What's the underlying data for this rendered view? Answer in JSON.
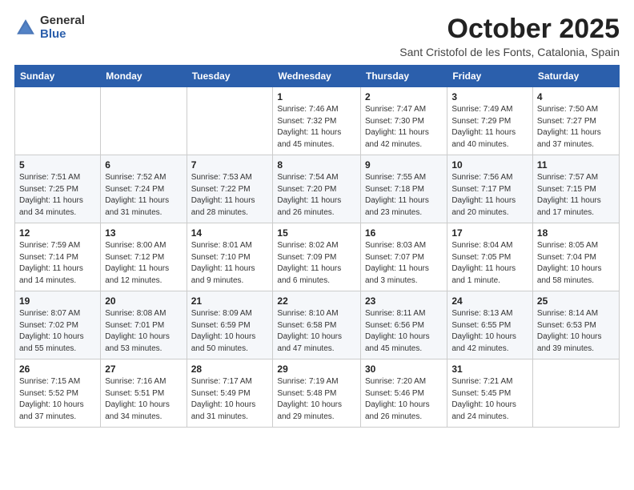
{
  "header": {
    "logo_general": "General",
    "logo_blue": "Blue",
    "month_title": "October 2025",
    "location": "Sant Cristofol de les Fonts, Catalonia, Spain"
  },
  "weekdays": [
    "Sunday",
    "Monday",
    "Tuesday",
    "Wednesday",
    "Thursday",
    "Friday",
    "Saturday"
  ],
  "rows": [
    [
      {
        "day": "",
        "info": ""
      },
      {
        "day": "",
        "info": ""
      },
      {
        "day": "",
        "info": ""
      },
      {
        "day": "1",
        "info": "Sunrise: 7:46 AM\nSunset: 7:32 PM\nDaylight: 11 hours\nand 45 minutes."
      },
      {
        "day": "2",
        "info": "Sunrise: 7:47 AM\nSunset: 7:30 PM\nDaylight: 11 hours\nand 42 minutes."
      },
      {
        "day": "3",
        "info": "Sunrise: 7:49 AM\nSunset: 7:29 PM\nDaylight: 11 hours\nand 40 minutes."
      },
      {
        "day": "4",
        "info": "Sunrise: 7:50 AM\nSunset: 7:27 PM\nDaylight: 11 hours\nand 37 minutes."
      }
    ],
    [
      {
        "day": "5",
        "info": "Sunrise: 7:51 AM\nSunset: 7:25 PM\nDaylight: 11 hours\nand 34 minutes."
      },
      {
        "day": "6",
        "info": "Sunrise: 7:52 AM\nSunset: 7:24 PM\nDaylight: 11 hours\nand 31 minutes."
      },
      {
        "day": "7",
        "info": "Sunrise: 7:53 AM\nSunset: 7:22 PM\nDaylight: 11 hours\nand 28 minutes."
      },
      {
        "day": "8",
        "info": "Sunrise: 7:54 AM\nSunset: 7:20 PM\nDaylight: 11 hours\nand 26 minutes."
      },
      {
        "day": "9",
        "info": "Sunrise: 7:55 AM\nSunset: 7:18 PM\nDaylight: 11 hours\nand 23 minutes."
      },
      {
        "day": "10",
        "info": "Sunrise: 7:56 AM\nSunset: 7:17 PM\nDaylight: 11 hours\nand 20 minutes."
      },
      {
        "day": "11",
        "info": "Sunrise: 7:57 AM\nSunset: 7:15 PM\nDaylight: 11 hours\nand 17 minutes."
      }
    ],
    [
      {
        "day": "12",
        "info": "Sunrise: 7:59 AM\nSunset: 7:14 PM\nDaylight: 11 hours\nand 14 minutes."
      },
      {
        "day": "13",
        "info": "Sunrise: 8:00 AM\nSunset: 7:12 PM\nDaylight: 11 hours\nand 12 minutes."
      },
      {
        "day": "14",
        "info": "Sunrise: 8:01 AM\nSunset: 7:10 PM\nDaylight: 11 hours\nand 9 minutes."
      },
      {
        "day": "15",
        "info": "Sunrise: 8:02 AM\nSunset: 7:09 PM\nDaylight: 11 hours\nand 6 minutes."
      },
      {
        "day": "16",
        "info": "Sunrise: 8:03 AM\nSunset: 7:07 PM\nDaylight: 11 hours\nand 3 minutes."
      },
      {
        "day": "17",
        "info": "Sunrise: 8:04 AM\nSunset: 7:05 PM\nDaylight: 11 hours\nand 1 minute."
      },
      {
        "day": "18",
        "info": "Sunrise: 8:05 AM\nSunset: 7:04 PM\nDaylight: 10 hours\nand 58 minutes."
      }
    ],
    [
      {
        "day": "19",
        "info": "Sunrise: 8:07 AM\nSunset: 7:02 PM\nDaylight: 10 hours\nand 55 minutes."
      },
      {
        "day": "20",
        "info": "Sunrise: 8:08 AM\nSunset: 7:01 PM\nDaylight: 10 hours\nand 53 minutes."
      },
      {
        "day": "21",
        "info": "Sunrise: 8:09 AM\nSunset: 6:59 PM\nDaylight: 10 hours\nand 50 minutes."
      },
      {
        "day": "22",
        "info": "Sunrise: 8:10 AM\nSunset: 6:58 PM\nDaylight: 10 hours\nand 47 minutes."
      },
      {
        "day": "23",
        "info": "Sunrise: 8:11 AM\nSunset: 6:56 PM\nDaylight: 10 hours\nand 45 minutes."
      },
      {
        "day": "24",
        "info": "Sunrise: 8:13 AM\nSunset: 6:55 PM\nDaylight: 10 hours\nand 42 minutes."
      },
      {
        "day": "25",
        "info": "Sunrise: 8:14 AM\nSunset: 6:53 PM\nDaylight: 10 hours\nand 39 minutes."
      }
    ],
    [
      {
        "day": "26",
        "info": "Sunrise: 7:15 AM\nSunset: 5:52 PM\nDaylight: 10 hours\nand 37 minutes."
      },
      {
        "day": "27",
        "info": "Sunrise: 7:16 AM\nSunset: 5:51 PM\nDaylight: 10 hours\nand 34 minutes."
      },
      {
        "day": "28",
        "info": "Sunrise: 7:17 AM\nSunset: 5:49 PM\nDaylight: 10 hours\nand 31 minutes."
      },
      {
        "day": "29",
        "info": "Sunrise: 7:19 AM\nSunset: 5:48 PM\nDaylight: 10 hours\nand 29 minutes."
      },
      {
        "day": "30",
        "info": "Sunrise: 7:20 AM\nSunset: 5:46 PM\nDaylight: 10 hours\nand 26 minutes."
      },
      {
        "day": "31",
        "info": "Sunrise: 7:21 AM\nSunset: 5:45 PM\nDaylight: 10 hours\nand 24 minutes."
      },
      {
        "day": "",
        "info": ""
      }
    ]
  ]
}
